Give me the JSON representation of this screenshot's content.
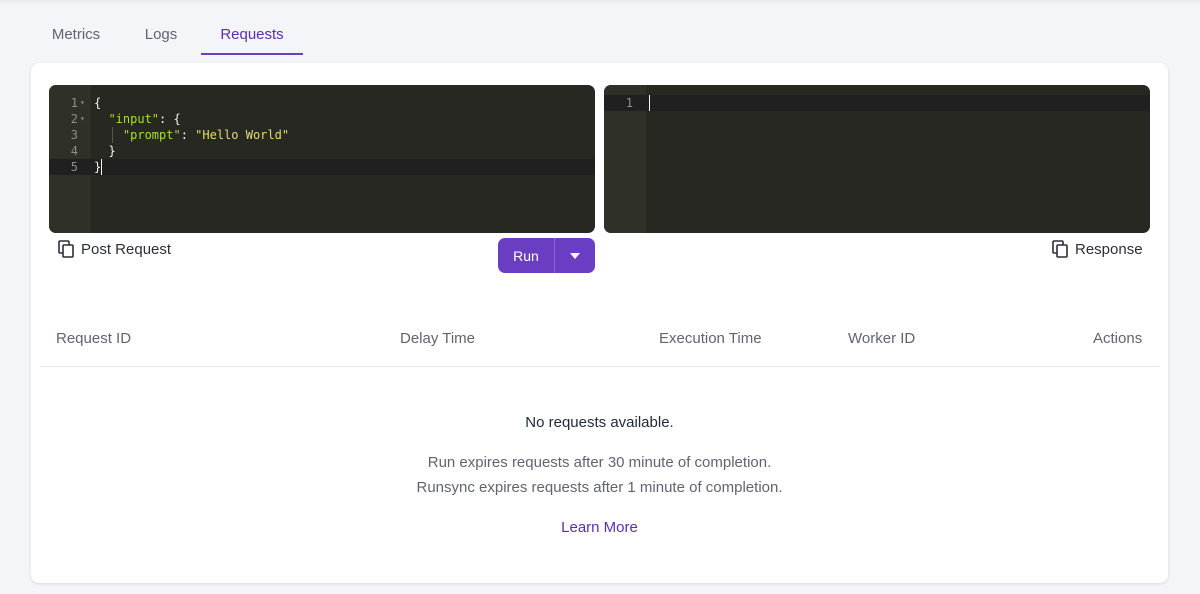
{
  "tabs": [
    {
      "label": "Metrics",
      "active": false
    },
    {
      "label": "Logs",
      "active": false
    },
    {
      "label": "Requests",
      "active": true
    }
  ],
  "editor_left": {
    "lines": [
      {
        "number": "1",
        "tokens": [
          {
            "t": "{",
            "c": "p"
          }
        ]
      },
      {
        "number": "2",
        "tokens": [
          {
            "t": "  ",
            "c": "p"
          },
          {
            "t": "\"input\"",
            "c": "k"
          },
          {
            "t": ": {",
            "c": "p"
          }
        ]
      },
      {
        "number": "3",
        "tokens": [
          {
            "t": "    ",
            "c": "p"
          },
          {
            "t": "\"prompt\"",
            "c": "k"
          },
          {
            "t": ": ",
            "c": "p"
          },
          {
            "t": "\"Hello World\"",
            "c": "s"
          }
        ]
      },
      {
        "number": "4",
        "tokens": [
          {
            "t": "  }",
            "c": "p"
          }
        ]
      },
      {
        "number": "5",
        "tokens": [
          {
            "t": "}",
            "c": "p"
          }
        ]
      }
    ]
  },
  "editor_right": {
    "lines": [
      {
        "number": "1"
      }
    ]
  },
  "post_request_label": "Post Request",
  "response_label": "Response",
  "run_label": "Run",
  "table": {
    "headers": {
      "request_id": "Request ID",
      "delay_time": "Delay Time",
      "execution_time": "Execution Time",
      "worker_id": "Worker ID",
      "actions": "Actions"
    }
  },
  "empty_state": {
    "title": "No requests available.",
    "line1": "Run expires requests after 30 minute of completion.",
    "line2": "Runsync expires requests after 1 minute of completion.",
    "learn_more": "Learn More"
  },
  "colors": {
    "accent": "#6a3dc2",
    "editor_bg": "#272822",
    "key": "#a6e22e",
    "string": "#e6db74"
  }
}
